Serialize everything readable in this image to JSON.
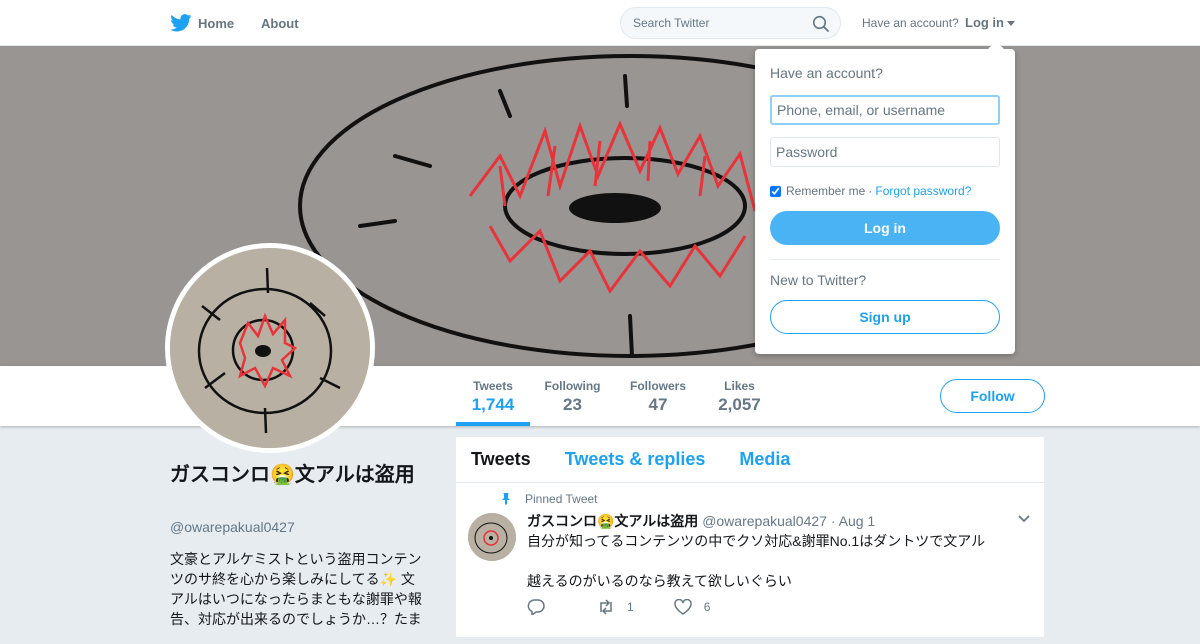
{
  "topbar": {
    "home_label": "Home",
    "about_label": "About",
    "search_placeholder": "Search Twitter",
    "have_account": "Have an account?",
    "login_label": "Log in"
  },
  "login_dropdown": {
    "title": "Have an account?",
    "username_placeholder": "Phone, email, or username",
    "password_placeholder": "Password",
    "remember_label": "Remember me",
    "separator": "·",
    "forgot_label": "Forgot password?",
    "login_button": "Log in",
    "new_prompt": "New to Twitter?",
    "signup_button": "Sign up"
  },
  "profile_nav": {
    "stats": [
      {
        "label": "Tweets",
        "value": "1,744"
      },
      {
        "label": "Following",
        "value": "23"
      },
      {
        "label": "Followers",
        "value": "47"
      },
      {
        "label": "Likes",
        "value": "2,057"
      }
    ],
    "follow_label": "Follow"
  },
  "profile": {
    "name": "ガスコンロ🤮文アルは盗用",
    "handle": "@owarepakual0427",
    "bio": "文豪とアルケミストという盗用コンテンツのサ終を心から楽しみにしてる✨ 文アルはいつになったらまともな謝罪や報告、対応が出来るのでしょうか…？たま"
  },
  "timeline": {
    "tabs": [
      "Tweets",
      "Tweets & replies",
      "Media"
    ],
    "pinned_label": "Pinned Tweet",
    "tweet": {
      "name": "ガスコンロ🤮文アルは盗用",
      "handle": "@owarepakual0427",
      "date": "· Aug 1",
      "text": "自分が知ってるコンテンツの中でクソ対応&謝罪No.1はダントツで文アル\n\n越えるのがいるのなら教えて欲しいぐらい",
      "retweets": "1",
      "likes": "6"
    }
  },
  "colors": {
    "accent": "#1da1f2",
    "banner_bg": "#949190",
    "ink_red": "#e8333a"
  }
}
